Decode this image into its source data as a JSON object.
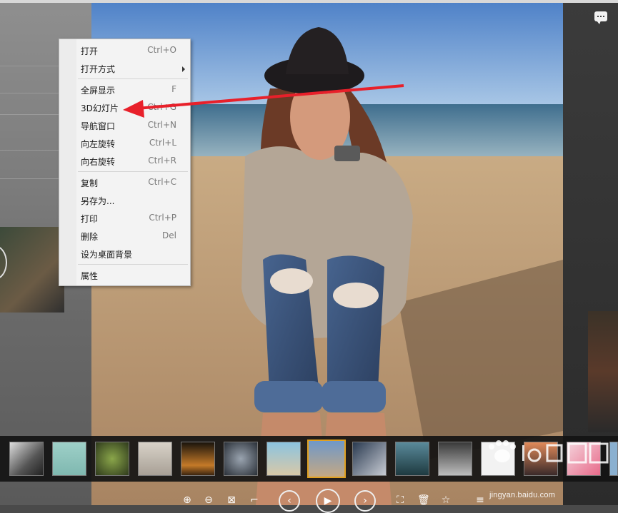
{
  "context_menu": {
    "items": [
      {
        "label": "打开",
        "shortcut": "Ctrl+O"
      },
      {
        "label": "打开方式",
        "shortcut": ""
      },
      {
        "label": "全屏显示",
        "shortcut": "F"
      },
      {
        "label": "3D幻灯片",
        "shortcut": "Ctrl+G"
      },
      {
        "label": "导航窗口",
        "shortcut": "Ctrl+N"
      },
      {
        "label": "向左旋转",
        "shortcut": "Ctrl+L"
      },
      {
        "label": "向右旋转",
        "shortcut": "Ctrl+R"
      },
      {
        "label": "复制",
        "shortcut": "Ctrl+C"
      },
      {
        "label": "另存为...",
        "shortcut": ""
      },
      {
        "label": "打印",
        "shortcut": "Ctrl+P"
      },
      {
        "label": "删除",
        "shortcut": "Del"
      },
      {
        "label": "设为桌面背景",
        "shortcut": ""
      },
      {
        "label": "属性",
        "shortcut": ""
      }
    ]
  },
  "toolbar": {
    "zoom_in": "⊕",
    "zoom_out": "⊖",
    "fit": "⊠",
    "crop": "⌐",
    "prev": "‹",
    "play": "▶",
    "next": "›",
    "fullscreen": "⛶",
    "delete": "🗑",
    "favorite": "☆",
    "menu": "≡"
  },
  "watermark": {
    "url": "jingyan.baidu.com"
  },
  "colors": {
    "annotation_arrow": "#e8202a",
    "active_thumb_border": "#e0a020"
  }
}
